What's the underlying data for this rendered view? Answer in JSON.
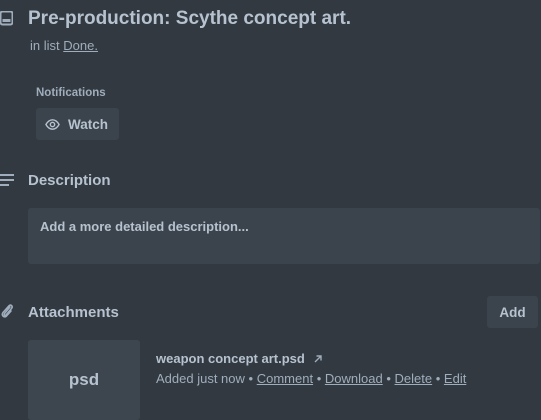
{
  "card": {
    "title": "Pre-production: Scythe concept art.",
    "in_list_prefix": "in list",
    "list_name": "Done."
  },
  "notifications": {
    "label": "Notifications",
    "watch_label": "Watch"
  },
  "description": {
    "title": "Description",
    "placeholder": "Add a more detailed description..."
  },
  "attachments": {
    "title": "Attachments",
    "add_label": "Add",
    "items": [
      {
        "thumb_text": "psd",
        "name": "weapon concept art.psd",
        "added": "Added just now",
        "sep": "•",
        "comment": "Comment",
        "download": "Download",
        "delete": "Delete",
        "edit": "Edit"
      }
    ]
  },
  "icons": {
    "card": "card-icon",
    "watch": "eye-icon",
    "description": "text-lines-icon",
    "attachments": "paperclip-icon",
    "open_external": "arrow-up-right-icon"
  },
  "colors": {
    "background": "#323940",
    "text": "#b6c2cf",
    "subtle_text": "#9fadbc",
    "button_bg": "#3b444c"
  }
}
